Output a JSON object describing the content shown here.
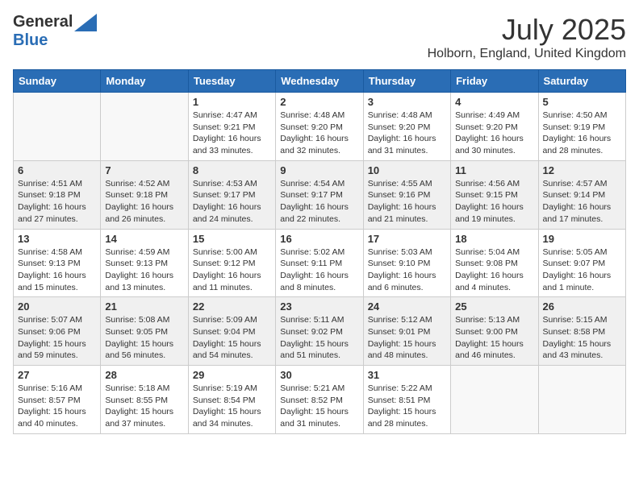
{
  "header": {
    "logo_general": "General",
    "logo_blue": "Blue",
    "month_year": "July 2025",
    "location": "Holborn, England, United Kingdom"
  },
  "weekdays": [
    "Sunday",
    "Monday",
    "Tuesday",
    "Wednesday",
    "Thursday",
    "Friday",
    "Saturday"
  ],
  "weeks": [
    [
      {
        "day": "",
        "sunrise": "",
        "sunset": "",
        "daylight": ""
      },
      {
        "day": "",
        "sunrise": "",
        "sunset": "",
        "daylight": ""
      },
      {
        "day": "1",
        "sunrise": "Sunrise: 4:47 AM",
        "sunset": "Sunset: 9:21 PM",
        "daylight": "Daylight: 16 hours and 33 minutes."
      },
      {
        "day": "2",
        "sunrise": "Sunrise: 4:48 AM",
        "sunset": "Sunset: 9:20 PM",
        "daylight": "Daylight: 16 hours and 32 minutes."
      },
      {
        "day": "3",
        "sunrise": "Sunrise: 4:48 AM",
        "sunset": "Sunset: 9:20 PM",
        "daylight": "Daylight: 16 hours and 31 minutes."
      },
      {
        "day": "4",
        "sunrise": "Sunrise: 4:49 AM",
        "sunset": "Sunset: 9:20 PM",
        "daylight": "Daylight: 16 hours and 30 minutes."
      },
      {
        "day": "5",
        "sunrise": "Sunrise: 4:50 AM",
        "sunset": "Sunset: 9:19 PM",
        "daylight": "Daylight: 16 hours and 28 minutes."
      }
    ],
    [
      {
        "day": "6",
        "sunrise": "Sunrise: 4:51 AM",
        "sunset": "Sunset: 9:18 PM",
        "daylight": "Daylight: 16 hours and 27 minutes."
      },
      {
        "day": "7",
        "sunrise": "Sunrise: 4:52 AM",
        "sunset": "Sunset: 9:18 PM",
        "daylight": "Daylight: 16 hours and 26 minutes."
      },
      {
        "day": "8",
        "sunrise": "Sunrise: 4:53 AM",
        "sunset": "Sunset: 9:17 PM",
        "daylight": "Daylight: 16 hours and 24 minutes."
      },
      {
        "day": "9",
        "sunrise": "Sunrise: 4:54 AM",
        "sunset": "Sunset: 9:17 PM",
        "daylight": "Daylight: 16 hours and 22 minutes."
      },
      {
        "day": "10",
        "sunrise": "Sunrise: 4:55 AM",
        "sunset": "Sunset: 9:16 PM",
        "daylight": "Daylight: 16 hours and 21 minutes."
      },
      {
        "day": "11",
        "sunrise": "Sunrise: 4:56 AM",
        "sunset": "Sunset: 9:15 PM",
        "daylight": "Daylight: 16 hours and 19 minutes."
      },
      {
        "day": "12",
        "sunrise": "Sunrise: 4:57 AM",
        "sunset": "Sunset: 9:14 PM",
        "daylight": "Daylight: 16 hours and 17 minutes."
      }
    ],
    [
      {
        "day": "13",
        "sunrise": "Sunrise: 4:58 AM",
        "sunset": "Sunset: 9:13 PM",
        "daylight": "Daylight: 16 hours and 15 minutes."
      },
      {
        "day": "14",
        "sunrise": "Sunrise: 4:59 AM",
        "sunset": "Sunset: 9:13 PM",
        "daylight": "Daylight: 16 hours and 13 minutes."
      },
      {
        "day": "15",
        "sunrise": "Sunrise: 5:00 AM",
        "sunset": "Sunset: 9:12 PM",
        "daylight": "Daylight: 16 hours and 11 minutes."
      },
      {
        "day": "16",
        "sunrise": "Sunrise: 5:02 AM",
        "sunset": "Sunset: 9:11 PM",
        "daylight": "Daylight: 16 hours and 8 minutes."
      },
      {
        "day": "17",
        "sunrise": "Sunrise: 5:03 AM",
        "sunset": "Sunset: 9:10 PM",
        "daylight": "Daylight: 16 hours and 6 minutes."
      },
      {
        "day": "18",
        "sunrise": "Sunrise: 5:04 AM",
        "sunset": "Sunset: 9:08 PM",
        "daylight": "Daylight: 16 hours and 4 minutes."
      },
      {
        "day": "19",
        "sunrise": "Sunrise: 5:05 AM",
        "sunset": "Sunset: 9:07 PM",
        "daylight": "Daylight: 16 hours and 1 minute."
      }
    ],
    [
      {
        "day": "20",
        "sunrise": "Sunrise: 5:07 AM",
        "sunset": "Sunset: 9:06 PM",
        "daylight": "Daylight: 15 hours and 59 minutes."
      },
      {
        "day": "21",
        "sunrise": "Sunrise: 5:08 AM",
        "sunset": "Sunset: 9:05 PM",
        "daylight": "Daylight: 15 hours and 56 minutes."
      },
      {
        "day": "22",
        "sunrise": "Sunrise: 5:09 AM",
        "sunset": "Sunset: 9:04 PM",
        "daylight": "Daylight: 15 hours and 54 minutes."
      },
      {
        "day": "23",
        "sunrise": "Sunrise: 5:11 AM",
        "sunset": "Sunset: 9:02 PM",
        "daylight": "Daylight: 15 hours and 51 minutes."
      },
      {
        "day": "24",
        "sunrise": "Sunrise: 5:12 AM",
        "sunset": "Sunset: 9:01 PM",
        "daylight": "Daylight: 15 hours and 48 minutes."
      },
      {
        "day": "25",
        "sunrise": "Sunrise: 5:13 AM",
        "sunset": "Sunset: 9:00 PM",
        "daylight": "Daylight: 15 hours and 46 minutes."
      },
      {
        "day": "26",
        "sunrise": "Sunrise: 5:15 AM",
        "sunset": "Sunset: 8:58 PM",
        "daylight": "Daylight: 15 hours and 43 minutes."
      }
    ],
    [
      {
        "day": "27",
        "sunrise": "Sunrise: 5:16 AM",
        "sunset": "Sunset: 8:57 PM",
        "daylight": "Daylight: 15 hours and 40 minutes."
      },
      {
        "day": "28",
        "sunrise": "Sunrise: 5:18 AM",
        "sunset": "Sunset: 8:55 PM",
        "daylight": "Daylight: 15 hours and 37 minutes."
      },
      {
        "day": "29",
        "sunrise": "Sunrise: 5:19 AM",
        "sunset": "Sunset: 8:54 PM",
        "daylight": "Daylight: 15 hours and 34 minutes."
      },
      {
        "day": "30",
        "sunrise": "Sunrise: 5:21 AM",
        "sunset": "Sunset: 8:52 PM",
        "daylight": "Daylight: 15 hours and 31 minutes."
      },
      {
        "day": "31",
        "sunrise": "Sunrise: 5:22 AM",
        "sunset": "Sunset: 8:51 PM",
        "daylight": "Daylight: 15 hours and 28 minutes."
      },
      {
        "day": "",
        "sunrise": "",
        "sunset": "",
        "daylight": ""
      },
      {
        "day": "",
        "sunrise": "",
        "sunset": "",
        "daylight": ""
      }
    ]
  ]
}
